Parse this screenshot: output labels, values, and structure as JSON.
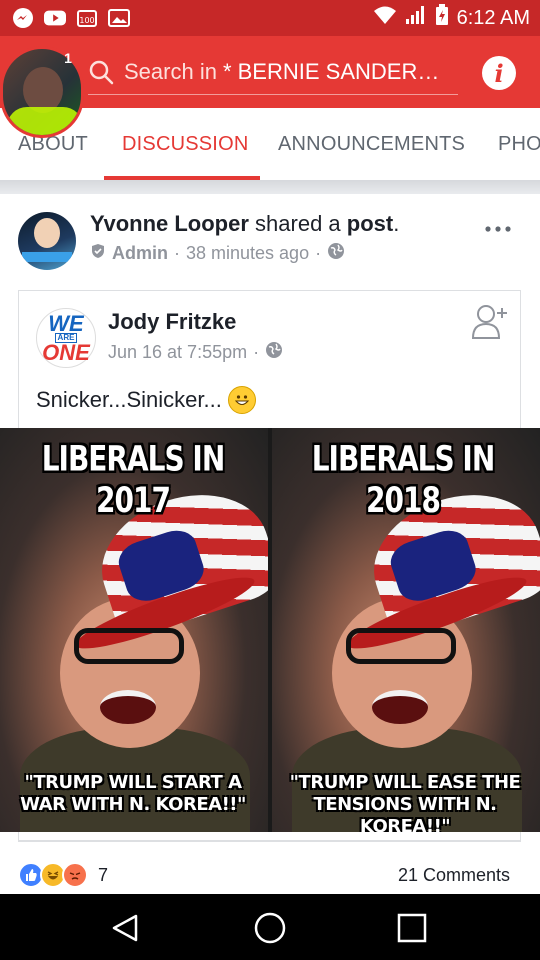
{
  "status_bar": {
    "time": "6:12 AM",
    "notification_icons": [
      "messenger-icon",
      "youtube-icon",
      "battery-saver-icon",
      "gallery-icon"
    ],
    "system_icons": [
      "wifi-icon",
      "signal-icon",
      "battery-icon"
    ]
  },
  "header": {
    "notification_count": "1",
    "search_placeholder": "Search in",
    "group_name": "* BERNIE SANDER…",
    "info_button": "i"
  },
  "tabs": [
    {
      "label": "ABOUT",
      "active": false
    },
    {
      "label": "DISCUSSION",
      "active": true
    },
    {
      "label": "ANNOUNCEMENTS",
      "active": false
    },
    {
      "label": "PHO",
      "active": false
    }
  ],
  "post": {
    "author": "Yvonne Looper",
    "action_text": "shared a",
    "action_object": "post",
    "action_end": ".",
    "role": "Admin",
    "timestamp": "38 minutes ago",
    "more_icon": "more-dots-icon",
    "shared": {
      "logo_lines": [
        "WE",
        "ARE",
        "ONE"
      ],
      "author": "Jody Fritzke",
      "date": "Jun 16 at 7:55pm",
      "text": "Snicker...Sinicker...",
      "emoji": "grinning-face-icon"
    },
    "meme": {
      "left_caption_top": "LIBERALS IN 2017",
      "left_caption_bottom": "\"TRUMP WILL START A WAR WITH N. KOREA!!\"",
      "right_caption_top": "LIBERALS IN 2018",
      "right_caption_bottom": "\"TRUMP WILL EASE THE TENSIONS WITH N. KOREA!!\""
    },
    "reactions": {
      "types": [
        "like",
        "haha",
        "angry"
      ],
      "count": "7"
    },
    "comments_label": "21 Comments"
  },
  "colors": {
    "status_bar": "#c62828",
    "header": "#e53935",
    "accent": "#e53935",
    "nav_bar": "#000000"
  }
}
